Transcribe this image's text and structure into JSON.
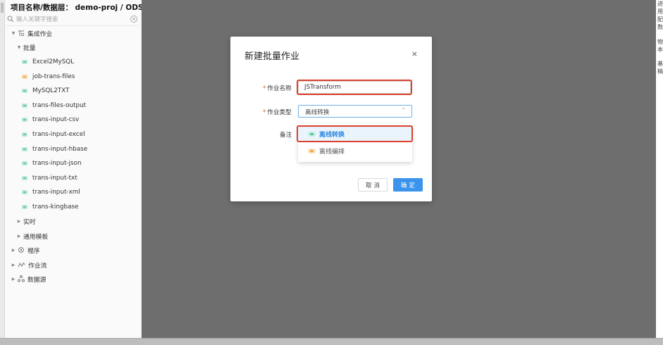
{
  "sidebar": {
    "title": "项目名称/数据层： demo-proj / ODS",
    "search_placeholder": "输入关键字搜索",
    "tree": {
      "integration": "集成作业",
      "batch": "批量",
      "jobs": [
        {
          "label": "Excel2MySQL",
          "icon": "batch-job-icon"
        },
        {
          "label": "job-trans-files",
          "icon": "orchestration-job-icon"
        },
        {
          "label": "MySQL2TXT",
          "icon": "batch-job-icon"
        },
        {
          "label": "trans-files-output",
          "icon": "batch-job-icon"
        },
        {
          "label": "trans-input-csv",
          "icon": "batch-job-icon"
        },
        {
          "label": "trans-input-excel",
          "icon": "batch-job-icon"
        },
        {
          "label": "trans-input-hbase",
          "icon": "batch-job-icon"
        },
        {
          "label": "trans-input-json",
          "icon": "batch-job-icon"
        },
        {
          "label": "trans-input-txt",
          "icon": "batch-job-icon"
        },
        {
          "label": "trans-input-xml",
          "icon": "batch-job-icon"
        },
        {
          "label": "trans-kingbase",
          "icon": "batch-job-icon"
        }
      ],
      "realtime": "实时",
      "template": "通用模板",
      "program": "程序",
      "workflow": "作业流",
      "datasource": "数据源"
    }
  },
  "right_panel": {
    "chars": [
      "进",
      "用",
      "配",
      "数",
      "物",
      "本",
      "基",
      "稿"
    ]
  },
  "modal": {
    "title": "新建批量作业",
    "close": "×",
    "fields": {
      "name_label": "作业名称",
      "name_value": "JSTransform",
      "type_label": "作业类型",
      "type_value": "离线转换",
      "remark_label": "备注"
    },
    "dropdown_options": [
      {
        "label": "离线转换",
        "icon": "offline-transform-icon",
        "selected": true
      },
      {
        "label": "离线编排",
        "icon": "offline-orchestration-icon",
        "selected": false
      }
    ],
    "cancel_label": "取 消",
    "ok_label": "确 定"
  },
  "colors": {
    "accent": "#3b93ec",
    "highlight_border": "#d9402d",
    "overlay": "#6e6e6e"
  }
}
